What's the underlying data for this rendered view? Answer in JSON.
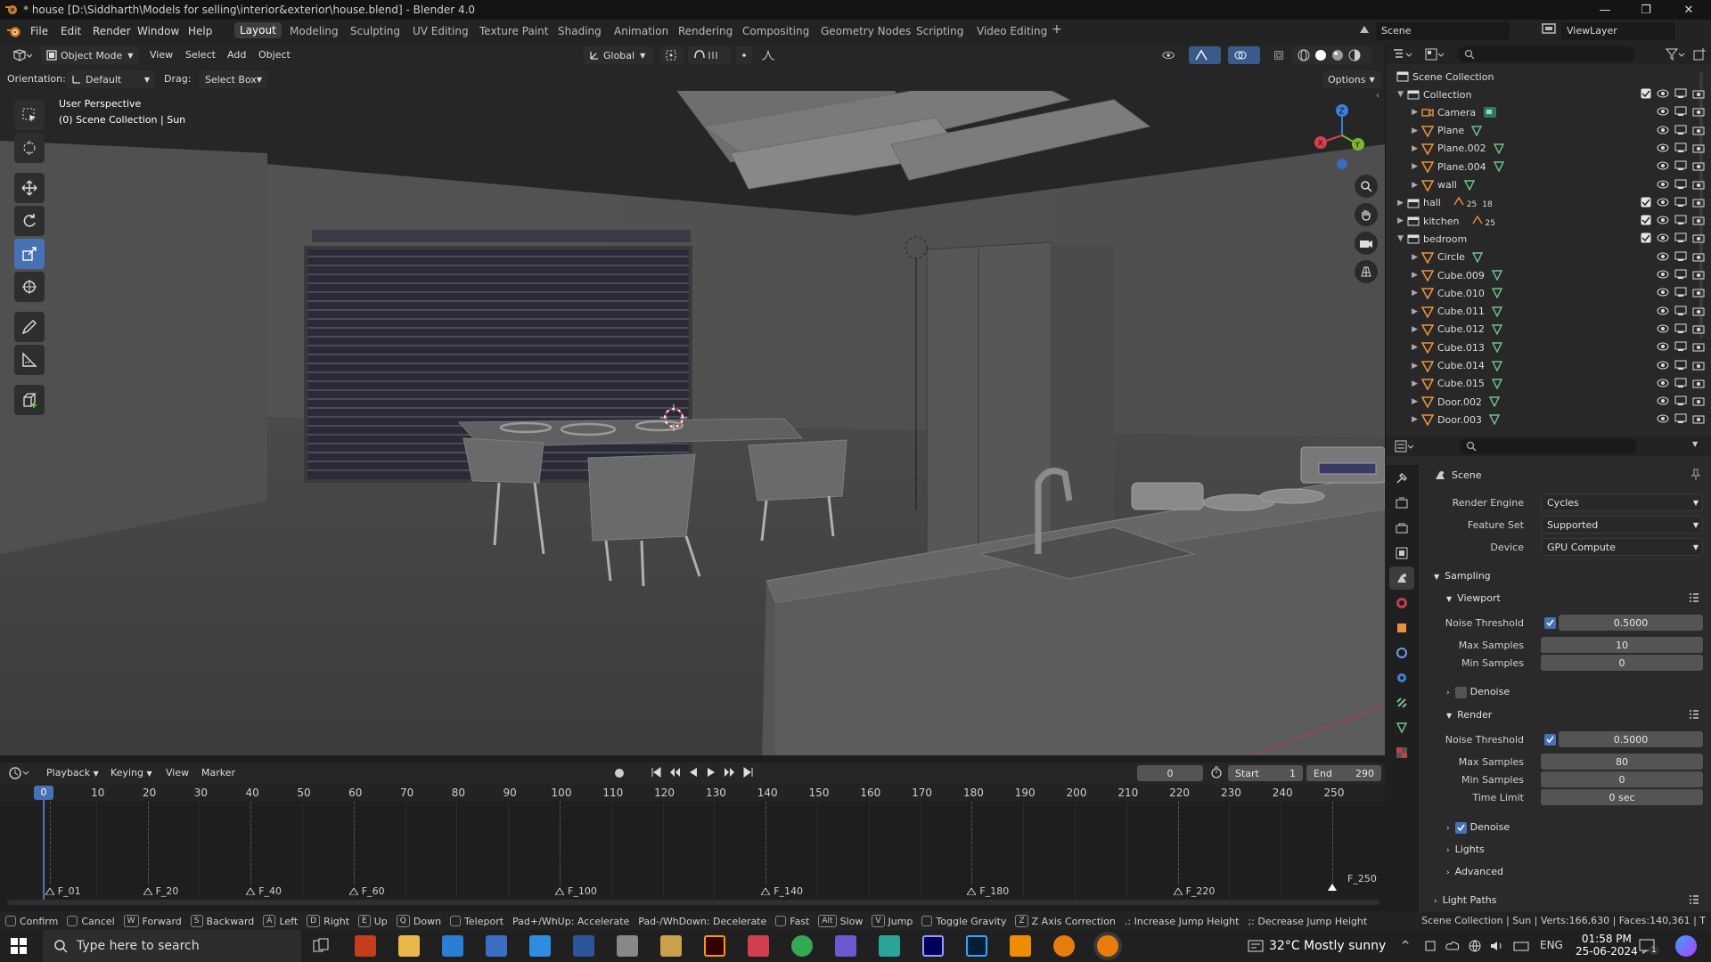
{
  "window": {
    "title": "* house [D:\\Siddharth\\Models for selling\\interior&exterior\\house.blend] - Blender 4.0",
    "minimize": "—",
    "maximize": "❐",
    "close": "✕"
  },
  "menus": [
    "File",
    "Edit",
    "Render",
    "Window",
    "Help"
  ],
  "workspaces": [
    "Layout",
    "Modeling",
    "Sculpting",
    "UV Editing",
    "Texture Paint",
    "Shading",
    "Animation",
    "Rendering",
    "Compositing",
    "Geometry Nodes",
    "Scripting",
    "Video Editing"
  ],
  "workspace_add": "+",
  "scene_field": "Scene",
  "viewlayer_field": "ViewLayer",
  "viewport_header": {
    "mode": "Object Mode",
    "menus": [
      "View",
      "Select",
      "Add",
      "Object"
    ],
    "transform": "Global",
    "orientation_label": "Orientation:",
    "orientation_value": "Default",
    "drag_label": "Drag:",
    "drag_value": "Select Box",
    "options": "Options"
  },
  "viewport_overlay": {
    "line1": "User Perspective",
    "line2": "(0) Scene Collection | Sun"
  },
  "gizmo": {
    "x": "X",
    "y": "Y",
    "z": "Z"
  },
  "outliner": {
    "root": "Scene Collection",
    "rows": [
      {
        "name": "Collection",
        "type": "collection",
        "indent": 0,
        "open": true
      },
      {
        "name": "Camera",
        "type": "object",
        "indent": 1
      },
      {
        "name": "Plane",
        "type": "object",
        "indent": 1
      },
      {
        "name": "Plane.002",
        "type": "object",
        "indent": 1
      },
      {
        "name": "Plane.004",
        "type": "object",
        "indent": 1
      },
      {
        "name": "wall",
        "type": "object",
        "indent": 1
      },
      {
        "name": "hall",
        "type": "collection",
        "indent": 0,
        "open": false
      },
      {
        "name": "kitchen",
        "type": "collection",
        "indent": 0,
        "open": false
      },
      {
        "name": "bedroom",
        "type": "collection",
        "indent": 0,
        "open": true
      },
      {
        "name": "Circle",
        "type": "object",
        "indent": 1
      },
      {
        "name": "Cube.009",
        "type": "object",
        "indent": 1
      },
      {
        "name": "Cube.010",
        "type": "object",
        "indent": 1
      },
      {
        "name": "Cube.011",
        "type": "object",
        "indent": 1
      },
      {
        "name": "Cube.012",
        "type": "object",
        "indent": 1
      },
      {
        "name": "Cube.013",
        "type": "object",
        "indent": 1
      },
      {
        "name": "Cube.014",
        "type": "object",
        "indent": 1
      },
      {
        "name": "Cube.015",
        "type": "object",
        "indent": 1
      },
      {
        "name": "Door.002",
        "type": "object",
        "indent": 1
      },
      {
        "name": "Door.003",
        "type": "object",
        "indent": 1
      }
    ],
    "hall_counts": [
      "25",
      "18"
    ],
    "kitchen_counts": [
      "25"
    ]
  },
  "properties": {
    "context": "Scene",
    "render_engine_label": "Render Engine",
    "render_engine": "Cycles",
    "feature_set_label": "Feature Set",
    "feature_set": "Supported",
    "device_label": "Device",
    "device": "GPU Compute",
    "sampling": "Sampling",
    "viewport": "Viewport",
    "noise_threshold_label": "Noise Threshold",
    "vp_noise": "0.5000",
    "max_samples_label": "Max Samples",
    "vp_max": "10",
    "min_samples_label": "Min Samples",
    "vp_min": "0",
    "denoise": "Denoise",
    "render": "Render",
    "r_noise": "0.5000",
    "r_max": "80",
    "r_min": "0",
    "time_limit_label": "Time Limit",
    "time_limit": "0 sec",
    "lights": "Lights",
    "advanced": "Advanced",
    "light_paths": "Light Paths"
  },
  "timeline": {
    "menus": [
      "Playback",
      "Keying",
      "View",
      "Marker"
    ],
    "current_frame": "0",
    "start_label": "Start",
    "start": "1",
    "end_label": "End",
    "end": "290",
    "ruler": [
      "0",
      "10",
      "20",
      "30",
      "40",
      "50",
      "60",
      "70",
      "80",
      "90",
      "100",
      "110",
      "120",
      "130",
      "140",
      "150",
      "160",
      "170",
      "180",
      "190",
      "200",
      "210",
      "220",
      "230",
      "240",
      "250"
    ],
    "markers": [
      "F_01",
      "F_20",
      "F_40",
      "F_60",
      "F_100",
      "F_140",
      "F_180",
      "F_220",
      "F_250"
    ]
  },
  "statusbar": {
    "items": [
      {
        "key": "",
        "label": "Confirm"
      },
      {
        "key": "",
        "label": "Cancel"
      },
      {
        "key": "W",
        "label": "Forward"
      },
      {
        "key": "S",
        "label": "Backward"
      },
      {
        "key": "A",
        "label": "Left"
      },
      {
        "key": "D",
        "label": "Right"
      },
      {
        "key": "E",
        "label": "Up"
      },
      {
        "key": "Q",
        "label": "Down"
      },
      {
        "key": "",
        "label": "Teleport"
      },
      {
        "key": "",
        "label": "Pad+/WhUp: Accelerate"
      },
      {
        "key": "",
        "label": "Pad-/WhDown: Decelerate"
      },
      {
        "key": "",
        "label": "Fast"
      },
      {
        "key": "Alt",
        "label": "Slow"
      },
      {
        "key": "V",
        "label": "Jump"
      },
      {
        "key": "",
        "label": "Toggle Gravity"
      },
      {
        "key": "Z",
        "label": "Z Axis Correction"
      },
      {
        "key": "",
        "label": ".: Increase Jump Height"
      },
      {
        "key": "",
        "label": ";: Decrease Jump Height"
      }
    ],
    "stats": "Scene Collection | Sun | Verts:166,630 | Faces:140,361 | T"
  },
  "taskbar": {
    "search_placeholder": "Type here to search",
    "weather": "32°C  Mostly sunny",
    "lang": "ENG",
    "time": "01:58 PM",
    "date": "25-06-2024",
    "notifications": "1"
  },
  "colors": {
    "accent": "#4772b3",
    "object_orange": "#e8913d",
    "mesh_green": "#6fc18c",
    "collection_white": "#d6d6d6"
  }
}
